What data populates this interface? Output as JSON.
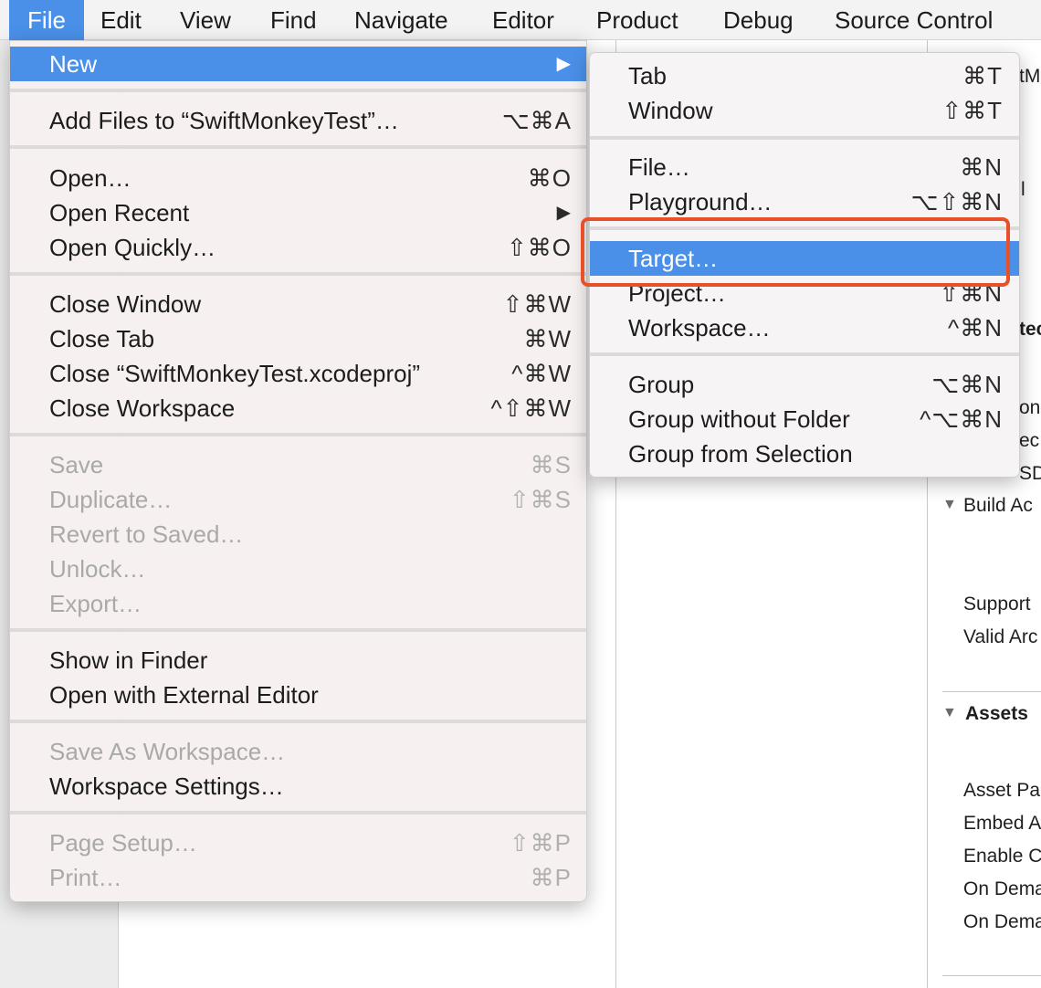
{
  "menubar": {
    "items": [
      "File",
      "Edit",
      "View",
      "Find",
      "Navigate",
      "Editor",
      "Product",
      "Debug",
      "Source Control"
    ]
  },
  "file_menu": {
    "new": {
      "label": "New",
      "shortcut": "▶"
    },
    "add_files": {
      "label": "Add Files to “SwiftMonkeyTest”…",
      "shortcut": "⌥⌘A"
    },
    "open": {
      "label": "Open…",
      "shortcut": "⌘O"
    },
    "open_recent": {
      "label": "Open Recent",
      "shortcut": "▶"
    },
    "open_quickly": {
      "label": "Open Quickly…",
      "shortcut": "⇧⌘O"
    },
    "close_window": {
      "label": "Close Window",
      "shortcut": "⇧⌘W"
    },
    "close_tab": {
      "label": "Close Tab",
      "shortcut": "⌘W"
    },
    "close_project": {
      "label": "Close “SwiftMonkeyTest.xcodeproj”",
      "shortcut": "^⌘W"
    },
    "close_workspace": {
      "label": "Close Workspace",
      "shortcut": "^⇧⌘W"
    },
    "save": {
      "label": "Save",
      "shortcut": "⌘S"
    },
    "duplicate": {
      "label": "Duplicate…",
      "shortcut": "⇧⌘S"
    },
    "revert": {
      "label": "Revert to Saved…",
      "shortcut": ""
    },
    "unlock": {
      "label": "Unlock…",
      "shortcut": ""
    },
    "export": {
      "label": "Export…",
      "shortcut": ""
    },
    "show_in_finder": {
      "label": "Show in Finder",
      "shortcut": ""
    },
    "open_external": {
      "label": "Open with External Editor",
      "shortcut": ""
    },
    "save_as_workspace": {
      "label": "Save As Workspace…",
      "shortcut": ""
    },
    "workspace_settings": {
      "label": "Workspace Settings…",
      "shortcut": ""
    },
    "page_setup": {
      "label": "Page Setup…",
      "shortcut": "⇧⌘P"
    },
    "print": {
      "label": "Print…",
      "shortcut": "⌘P"
    }
  },
  "new_submenu": {
    "tab": {
      "label": "Tab",
      "shortcut": "⌘T"
    },
    "window": {
      "label": "Window",
      "shortcut": "⇧⌘T"
    },
    "file": {
      "label": "File…",
      "shortcut": "⌘N"
    },
    "playground": {
      "label": "Playground…",
      "shortcut": "⌥⇧⌘N"
    },
    "target": {
      "label": "Target…",
      "shortcut": ""
    },
    "project": {
      "label": "Project…",
      "shortcut": "⇧⌘N"
    },
    "workspace": {
      "label": "Workspace…",
      "shortcut": "^⌘N"
    },
    "group": {
      "label": "Group",
      "shortcut": "⌥⌘N"
    },
    "group_without_folder": {
      "label": "Group without Folder",
      "shortcut": "^⌥⌘N"
    },
    "group_from_selection": {
      "label": "Group from Selection",
      "shortcut": ""
    }
  },
  "inspector": {
    "frag1": "tMo",
    "frag2": "l",
    "frag3": "tec",
    "frag4": "on",
    "frag5": "ec",
    "frag6": "SD",
    "build_active": "Build Ac",
    "supported": "Support",
    "valid_arch": "Valid Arc",
    "assets_header": "Assets",
    "asset_pack": "Asset Pa",
    "embed": "Embed A",
    "enable": "Enable C",
    "on_demand_1": "On Dema",
    "on_demand_2": "On Dema"
  },
  "colors": {
    "highlight": "#4a90e8",
    "annotation": "#e8502a"
  }
}
